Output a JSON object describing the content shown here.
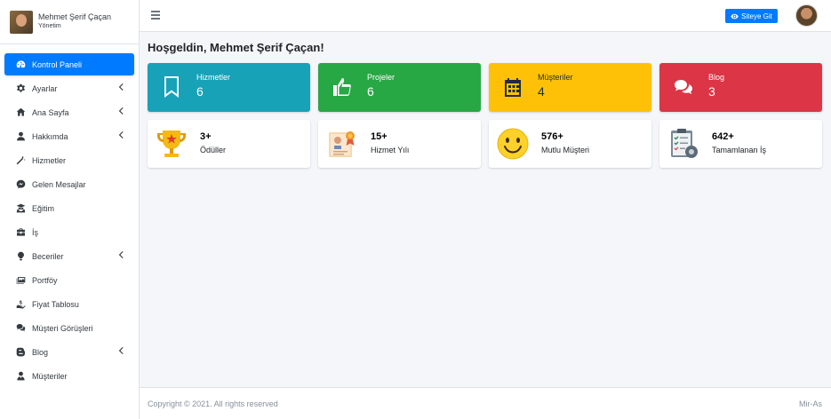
{
  "brand": {
    "name": "Mehmet Şerif Çaçan",
    "role": "Yönetim"
  },
  "sidebar": {
    "items": [
      {
        "label": "Kontrol Paneli",
        "icon": "dashboard-icon",
        "active": true,
        "chevron": false
      },
      {
        "label": "Ayarlar",
        "icon": "gear-icon",
        "chevron": true
      },
      {
        "label": "Ana Sayfa",
        "icon": "home-icon",
        "chevron": true
      },
      {
        "label": "Hakkımda",
        "icon": "user-icon",
        "chevron": true
      },
      {
        "label": "Hizmetler",
        "icon": "magic-wand-icon",
        "chevron": false
      },
      {
        "label": "Gelen Mesajlar",
        "icon": "messenger-icon",
        "chevron": false
      },
      {
        "label": "Eğitim",
        "icon": "graduate-icon",
        "chevron": false
      },
      {
        "label": "İş",
        "icon": "briefcase-icon",
        "chevron": false
      },
      {
        "label": "Beceriler",
        "icon": "lightbulb-icon",
        "chevron": true
      },
      {
        "label": "Portföy",
        "icon": "images-icon",
        "chevron": false
      },
      {
        "label": "Fiyat Tablosu",
        "icon": "hand-holding-dollar-icon",
        "chevron": false
      },
      {
        "label": "Müşteri Görüşleri",
        "icon": "comments-icon",
        "chevron": false
      },
      {
        "label": "Blog",
        "icon": "blogger-icon",
        "chevron": true
      },
      {
        "label": "Müşteriler",
        "icon": "user-tie-icon",
        "chevron": false
      }
    ]
  },
  "topbar": {
    "site_button": "Siteye Git"
  },
  "page": {
    "title": "Hoşgeldin, Mehmet Şerif Çaçan!"
  },
  "info_cards": [
    {
      "label": "Hizmetler",
      "value": "6",
      "color": "#17a2b8",
      "icon": "bookmark-icon"
    },
    {
      "label": "Projeler",
      "value": "6",
      "color": "#28a745",
      "icon": "thumbs-up-icon"
    },
    {
      "label": "Müşteriler",
      "value": "4",
      "color": "#ffc107",
      "icon": "calendar-icon"
    },
    {
      "label": "Blog",
      "value": "3",
      "color": "#dc3545",
      "icon": "comments-icon"
    }
  ],
  "stat_cards": [
    {
      "value": "3+",
      "label": "Ödüller",
      "icon": "trophy-icon"
    },
    {
      "value": "15+",
      "label": "Hizmet Yılı",
      "icon": "certificate-icon"
    },
    {
      "value": "576+",
      "label": "Mutlu Müşteri",
      "icon": "smiley-icon"
    },
    {
      "value": "642+",
      "label": "Tamamlanan İş",
      "icon": "clipboard-gear-icon"
    }
  ],
  "footer": {
    "copyright": "Copyright © 2021. All rights reserved",
    "right": "Mir-As"
  }
}
